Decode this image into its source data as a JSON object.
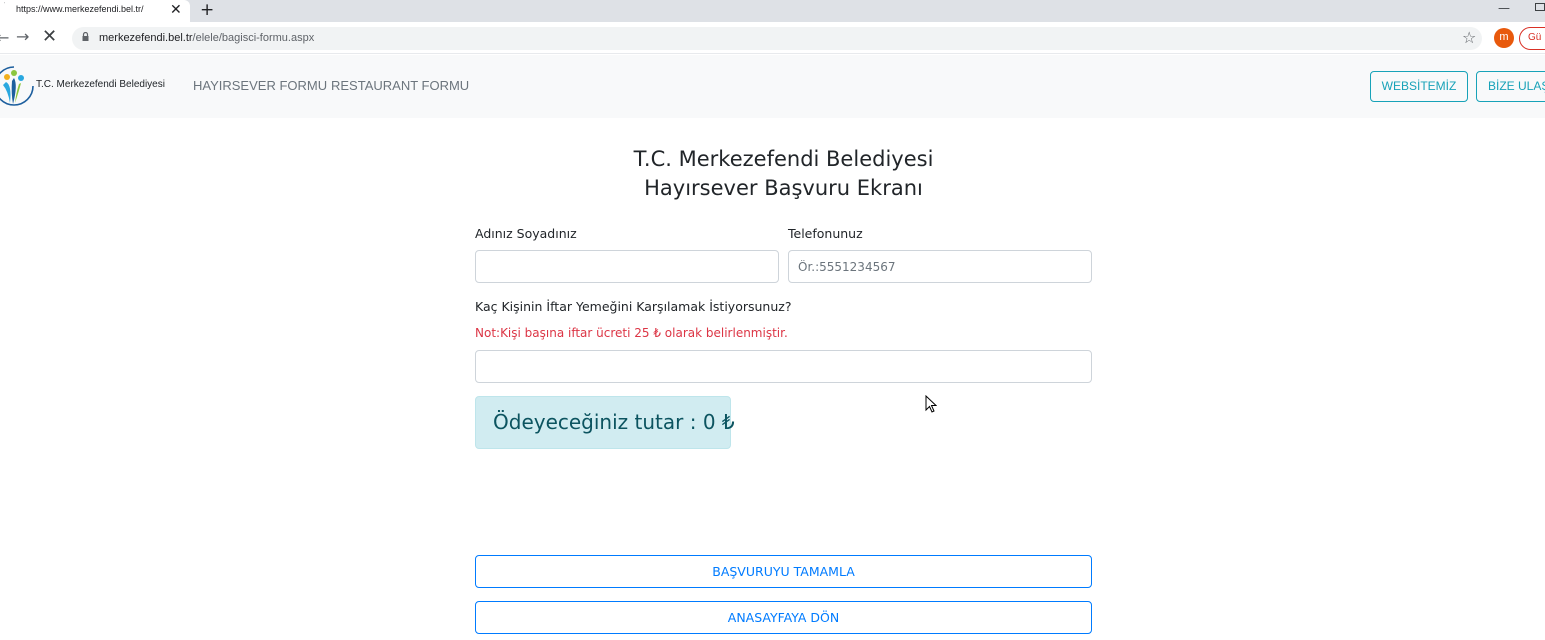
{
  "browser": {
    "tab_title": "https://www.merkezefendi.bel.tr/",
    "tab_close": "✕",
    "new_tab": "+",
    "url_host": "merkezefendi.bel.tr",
    "url_path": "/elele/bagisci-formu.aspx",
    "profile_initial": "m",
    "guest_label": "Gü"
  },
  "navbar": {
    "brand": "T.C. Merkezefendi Belediyesi",
    "links": [
      "HAYIRSEVER FORMU",
      "RESTAURANT FORMU"
    ],
    "website_button": "WEBSİTEMİZ",
    "contact_button": "BİZE ULAŞ"
  },
  "form": {
    "title_line1": "T.C. Merkezefendi Belediyesi",
    "title_line2": "Hayırsever Başvuru Ekranı",
    "name_label": "Adınız Soyadınız",
    "name_value": "",
    "phone_label": "Telefonunuz",
    "phone_placeholder": "Ör.:5551234567",
    "count_label": "Kaç Kişinin İftar Yemeğini Karşılamak İstiyorsunuz?",
    "note": "Not:Kişi başına iftar ücreti 25 ₺ olarak belirlenmiştir.",
    "count_value": "",
    "total_text": "Ödeyeceğiniz tutar : 0 ₺",
    "submit_button": "BAŞVURUYU TAMAMLA",
    "home_button": "ANASAYFAYA DÖN"
  },
  "colors": {
    "accent_info": "#17a2b8",
    "accent_primary": "#007bff",
    "note_red": "#dc3545",
    "alert_bg": "#d1ecf1"
  }
}
